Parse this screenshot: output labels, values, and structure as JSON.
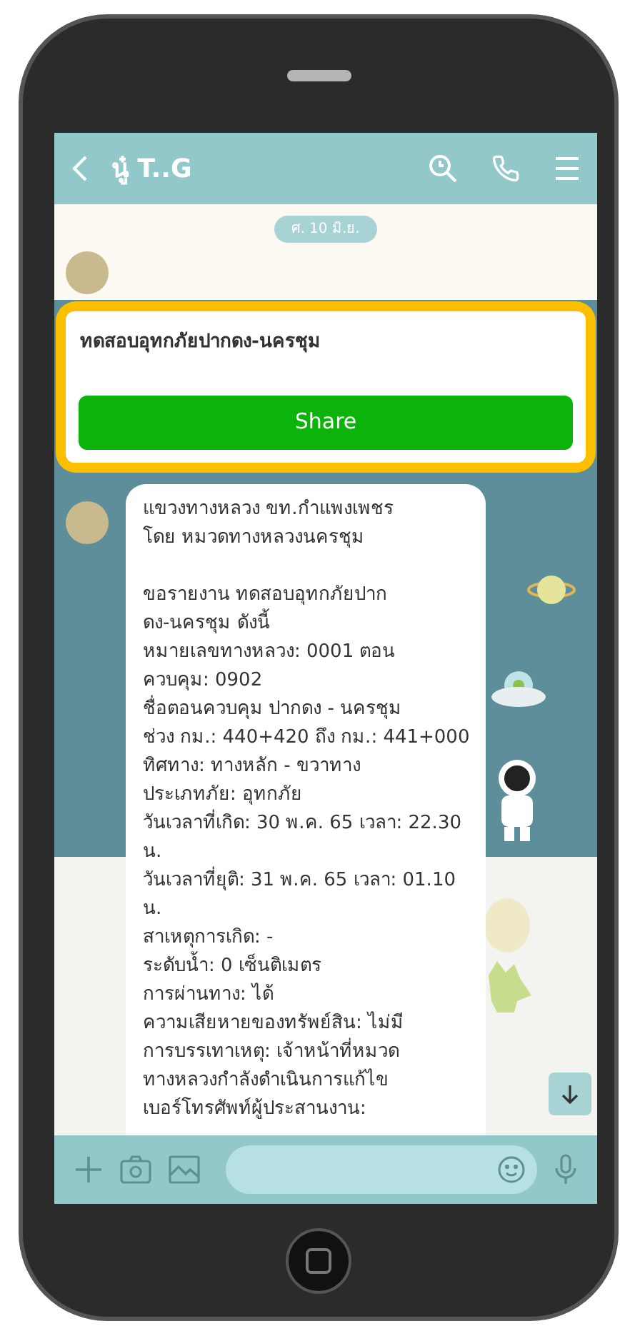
{
  "header": {
    "title": "นู๋ T..G"
  },
  "date_badge": "ศ. 10 มิ.ย.",
  "shared_card": {
    "title": "ทดสอบอุทกภัยปากดง-นครชุม",
    "button": "Share"
  },
  "message": {
    "paragraphs": [
      [
        "แขวงทางหลวง ขท.กำแพงเพชร",
        "โดย หมวดทางหลวงนครชุม"
      ],
      [
        "ขอรายงาน ทดสอบอุทกภัยปาก",
        "ดง-นครชุม ดังนี้",
        "หมายเลขทางหลวง: 0001 ตอน",
        "ควบคุม: 0902",
        "ชื่อตอนควบคุม ปากดง - นครชุม",
        "ช่วง กม.: 440+420 ถึง กม.: 441+000",
        "ทิศทาง: ทางหลัก - ขวาทาง",
        "ประเภทภัย: อุทกภัย",
        "วันเวลาที่เกิด: 30 พ.ค. 65 เวลา: 22.30",
        "น.",
        "วันเวลาที่ยุติ: 31 พ.ค. 65 เวลา: 01.10",
        "น.",
        "สาเหตุการเกิด: -",
        "ระดับน้ำ: 0 เซ็นติเมตร",
        "การผ่านทาง: ได้",
        "ความเสียหายของทรัพย์สิน: ไม่มี",
        "การบรรเทาเหตุ: เจ้าหน้าที่หมวด",
        "ทางหลวงกำลังดำเนินการแก้ไข",
        "เบอร์โทรศัพท์ผู้ประสานงาน:"
      ]
    ]
  }
}
